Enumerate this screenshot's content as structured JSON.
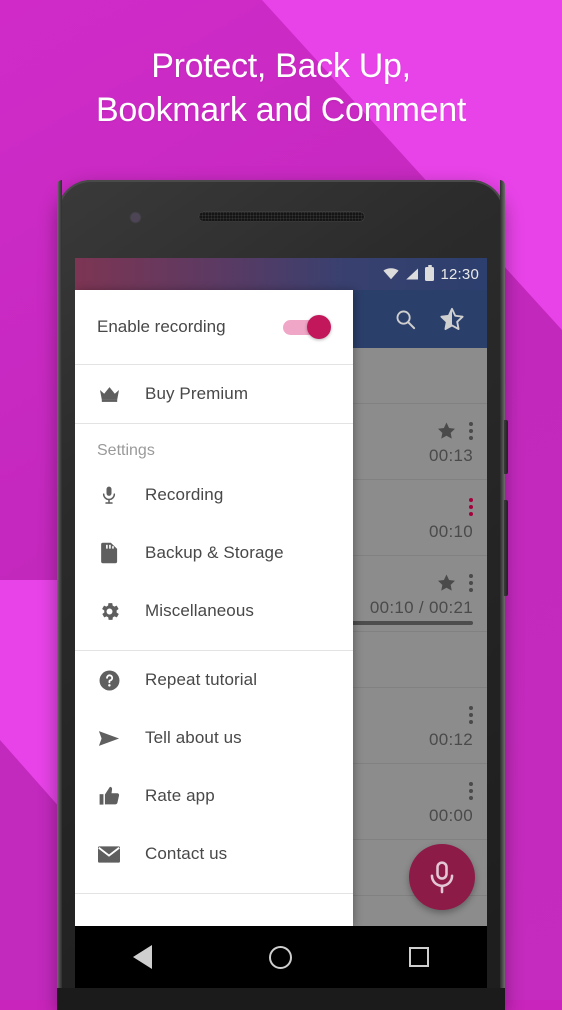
{
  "promo": {
    "headline_line1": "Protect, Back Up,",
    "headline_line2": "Bookmark and Comment",
    "background_color": "#c328bd",
    "accent_color": "#e843e8"
  },
  "phone": {
    "statusbar": {
      "time": "12:30",
      "icons": [
        "wifi-icon",
        "signal-icon",
        "battery-icon"
      ]
    },
    "appbar": {
      "color": "#2b3f6b",
      "actions": [
        {
          "name": "search-icon",
          "label": "Search"
        },
        {
          "name": "favorites-star-icon",
          "label": "Favorites"
        }
      ]
    },
    "navbar": {
      "buttons": [
        "back-button",
        "home-button",
        "recents-button"
      ]
    }
  },
  "recordings": [
    {
      "duration": "00:13",
      "starred": true,
      "accent_menu": false,
      "has_seek": false
    },
    {
      "duration": "00:10",
      "starred": false,
      "accent_menu": true,
      "has_seek": false
    },
    {
      "duration": "00:10 / 00:21",
      "starred": true,
      "accent_menu": false,
      "has_seek": true
    },
    {
      "duration": "00:12",
      "starred": false,
      "accent_menu": false,
      "has_seek": false
    },
    {
      "duration": "00:00",
      "starred": false,
      "accent_menu": false,
      "has_seek": false
    }
  ],
  "fab": {
    "name": "record-microphone-fab",
    "color": "#8d1b47"
  },
  "drawer": {
    "toggle": {
      "label": "Enable recording",
      "state": "on",
      "track_color": "#f0a6c6",
      "thumb_color": "#c2185b"
    },
    "premium": {
      "label": "Buy Premium",
      "icon": "crown-icon"
    },
    "settings_header": "Settings",
    "settings_items": [
      {
        "label": "Recording",
        "icon": "microphone-icon"
      },
      {
        "label": "Backup & Storage",
        "icon": "sd-card-icon"
      },
      {
        "label": "Miscellaneous",
        "icon": "gear-icon"
      }
    ],
    "other_items": [
      {
        "label": "Repeat tutorial",
        "icon": "help-circle-icon"
      },
      {
        "label": "Tell about us",
        "icon": "send-icon"
      },
      {
        "label": "Rate app",
        "icon": "thumbs-up-icon"
      },
      {
        "label": "Contact us",
        "icon": "envelope-icon"
      }
    ]
  }
}
